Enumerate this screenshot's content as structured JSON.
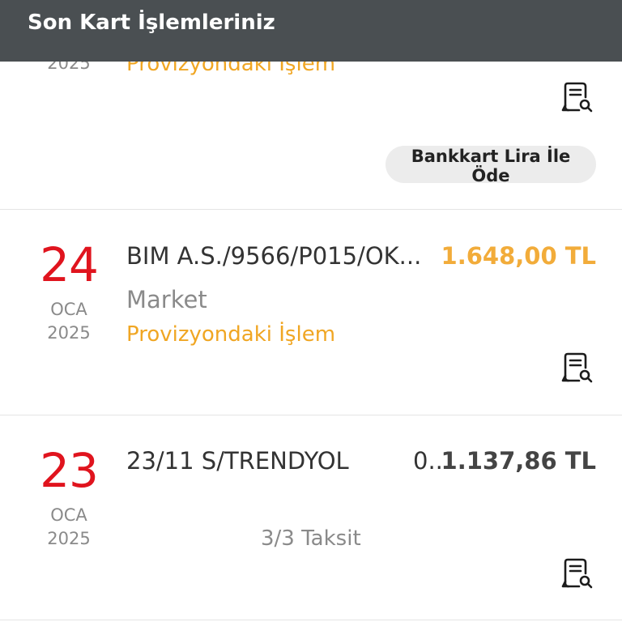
{
  "header": {
    "title": "Son Kart İşlemleriniz"
  },
  "partial": {
    "year": "2025",
    "status": "Provizyondaki İşlem",
    "pay_button": "Bankkart Lira İle Öde"
  },
  "transactions": [
    {
      "day": "24",
      "month": "OCA",
      "year": "2025",
      "merchant": "BIM A.S./9566/P015/OK...",
      "amount": "1.648,00 TL",
      "category": "Market",
      "status": "Provizyondaki İşlem"
    },
    {
      "day": "23",
      "month": "OCA",
      "year": "2025",
      "merchant": "23/11 S/TRENDYOL",
      "merchant_tail": "0...",
      "amount": "1.137,86 TL",
      "installment": "3/3 Taksit"
    }
  ],
  "icons": {
    "receipt": "receipt-search-icon"
  }
}
